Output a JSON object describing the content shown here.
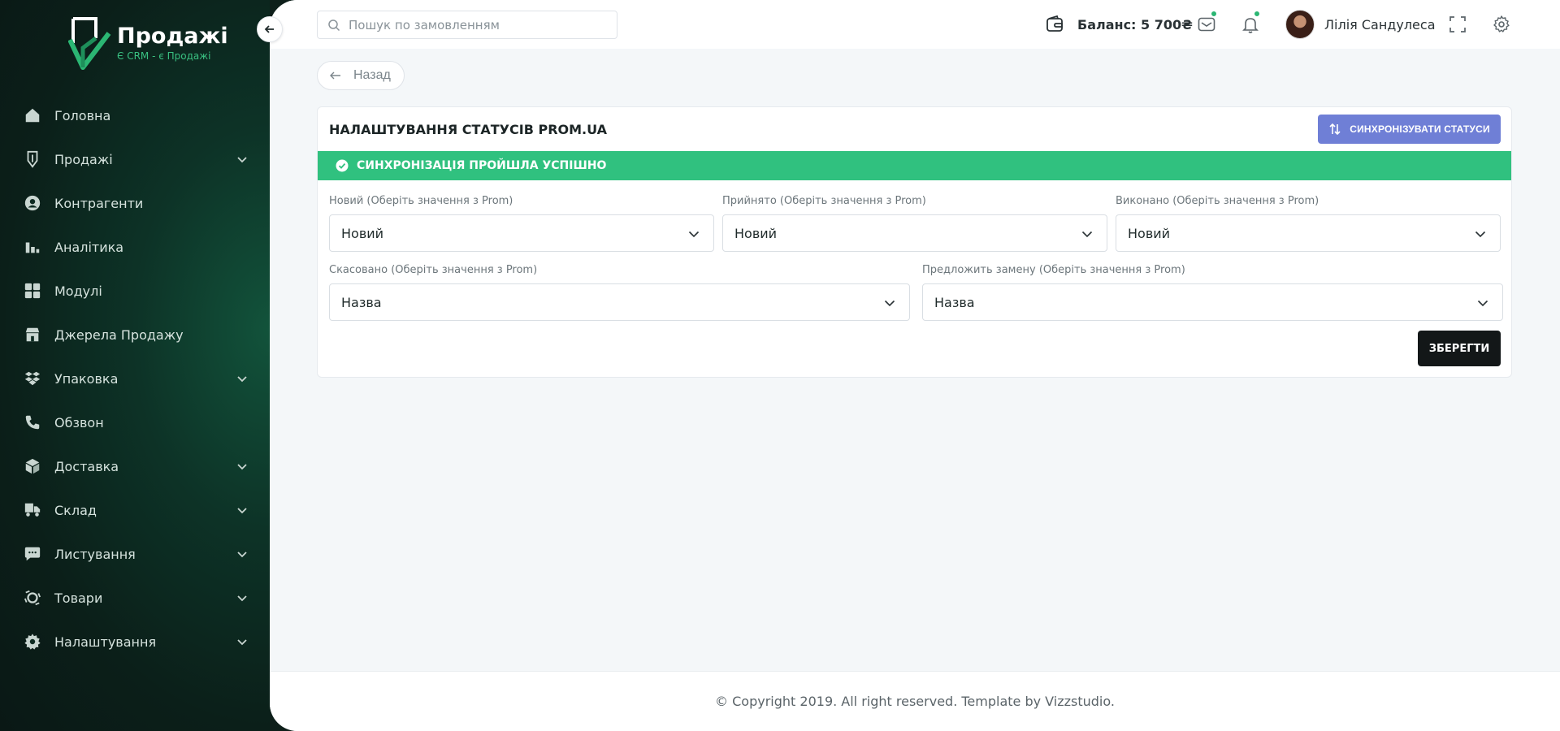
{
  "brand": {
    "title": "Продажі",
    "subtitle": "Є CRM - є Продажі"
  },
  "sidebar": {
    "items": [
      {
        "label": "Головна",
        "icon": "home-icon",
        "has_submenu": false
      },
      {
        "label": "Продажі",
        "icon": "tag-icon",
        "has_submenu": true
      },
      {
        "label": "Контрагенти",
        "icon": "user-circle-icon",
        "has_submenu": false
      },
      {
        "label": "Аналітика",
        "icon": "bar-chart-icon",
        "has_submenu": false
      },
      {
        "label": "Модулі",
        "icon": "grid-icon",
        "has_submenu": false
      },
      {
        "label": "Джерела Продажу",
        "icon": "store-icon",
        "has_submenu": false
      },
      {
        "label": "Упаковка",
        "icon": "boxes-icon",
        "has_submenu": true
      },
      {
        "label": "Обзвон",
        "icon": "phone-icon",
        "has_submenu": false
      },
      {
        "label": "Доставка",
        "icon": "package-icon",
        "has_submenu": true
      },
      {
        "label": "Склад",
        "icon": "truck-icon",
        "has_submenu": true
      },
      {
        "label": "Листування",
        "icon": "chat-icon",
        "has_submenu": true
      },
      {
        "label": "Товари",
        "icon": "products-icon",
        "has_submenu": true
      },
      {
        "label": "Налаштування",
        "icon": "gear-icon",
        "has_submenu": true
      }
    ]
  },
  "topbar": {
    "search_placeholder": "Пошук по замовленням",
    "balance": "Баланс: 5 700₴",
    "user_name": "Лілія Сандулеса"
  },
  "back_label": "Назад",
  "card": {
    "title": "НАЛАШТУВАННЯ СТАТУСІВ PROM.UA",
    "sync_button": "СИНХРОНІЗУВАТИ СТАТУСИ",
    "alert": "СИНХРОНІЗАЦІЯ ПРОЙШЛА УСПІШНО",
    "fields": [
      {
        "label": "Новий (Оберіть значення з Prom)",
        "value": "Новий"
      },
      {
        "label": "Прийнято (Оберіть значення з Prom)",
        "value": "Новий"
      },
      {
        "label": "Виконано (Оберіть значення з Prom)",
        "value": "Новий"
      },
      {
        "label": "Скасовано (Оберіть значення з Prom)",
        "value": "Назва"
      },
      {
        "label": "Предложить замену (Оберіть значення з Prom)",
        "value": "Назва"
      }
    ],
    "save_button": "ЗБЕРЕГТИ"
  },
  "footer": "© Copyright 2019. All right reserved. Template by Vizzstudio.",
  "colors": {
    "accent_green": "#30c17f",
    "sync_button": "#6f7fd6",
    "save_button": "#131718",
    "sidebar_bg": "#0b1f19"
  }
}
